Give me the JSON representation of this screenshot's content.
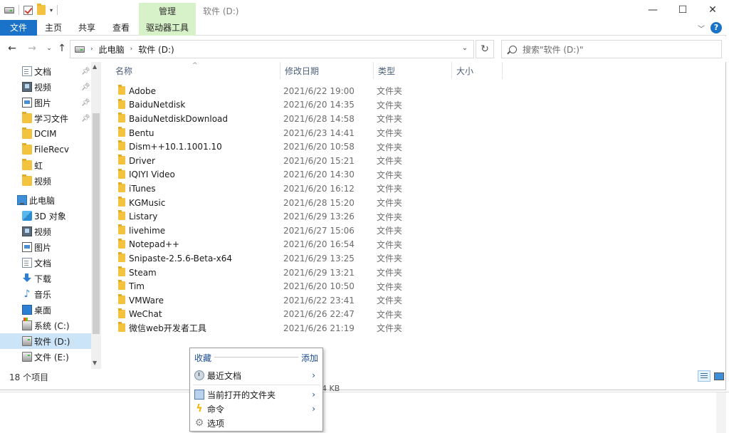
{
  "title_bar": {
    "title": "软件 (D:)",
    "context_tab_group": "管理",
    "minimize_icon": "minimize-icon",
    "maximize_icon": "maximize-icon",
    "close_icon": "close-icon"
  },
  "ribbon": {
    "tabs": [
      "文件",
      "主页",
      "共享",
      "查看",
      "驱动器工具"
    ],
    "help": "?"
  },
  "address": {
    "crumbs": [
      "此电脑",
      "软件 (D:)"
    ],
    "search_placeholder": "搜索\"软件 (D:)\""
  },
  "navpane": {
    "quick_access": [
      {
        "label": "文档",
        "icon": "document-icon",
        "pinned": true
      },
      {
        "label": "视频",
        "icon": "video-icon",
        "pinned": true
      },
      {
        "label": "图片",
        "icon": "picture-icon",
        "pinned": true
      },
      {
        "label": "学习文件",
        "icon": "folder-icon",
        "pinned": true
      },
      {
        "label": "DCIM",
        "icon": "folder-icon",
        "pinned": false
      },
      {
        "label": "FileRecv",
        "icon": "folder-icon",
        "pinned": false
      },
      {
        "label": "虹",
        "icon": "folder-icon",
        "pinned": false
      },
      {
        "label": "视频",
        "icon": "folder-icon",
        "pinned": false
      }
    ],
    "this_pc": "此电脑",
    "pc_items": [
      {
        "label": "3D 对象",
        "icon": "3d-objects-icon"
      },
      {
        "label": "视频",
        "icon": "video-icon"
      },
      {
        "label": "图片",
        "icon": "picture-icon"
      },
      {
        "label": "文档",
        "icon": "document-icon"
      },
      {
        "label": "下载",
        "icon": "download-icon"
      },
      {
        "label": "音乐",
        "icon": "music-icon"
      },
      {
        "label": "桌面",
        "icon": "desktop-icon"
      },
      {
        "label": "系统 (C:)",
        "icon": "system-drive-icon"
      },
      {
        "label": "软件 (D:)",
        "icon": "drive-icon",
        "selected": true
      },
      {
        "label": "文件 (E:)",
        "icon": "drive-icon"
      }
    ]
  },
  "columns": {
    "name": "名称",
    "date": "修改日期",
    "type": "类型",
    "size": "大小"
  },
  "files": [
    {
      "name": "Adobe",
      "date": "2021/6/22 19:00",
      "type": "文件夹"
    },
    {
      "name": "BaiduNetdisk",
      "date": "2021/6/20 14:35",
      "type": "文件夹"
    },
    {
      "name": "BaiduNetdiskDownload",
      "date": "2021/6/28 14:58",
      "type": "文件夹"
    },
    {
      "name": "Bentu",
      "date": "2021/6/23 14:41",
      "type": "文件夹"
    },
    {
      "name": "Dism++10.1.1001.10",
      "date": "2021/6/20 10:58",
      "type": "文件夹"
    },
    {
      "name": "Driver",
      "date": "2021/6/20 15:21",
      "type": "文件夹"
    },
    {
      "name": "IQIYI Video",
      "date": "2021/6/20 14:30",
      "type": "文件夹"
    },
    {
      "name": "iTunes",
      "date": "2021/6/20 16:12",
      "type": "文件夹"
    },
    {
      "name": "KGMusic",
      "date": "2021/6/28 15:20",
      "type": "文件夹"
    },
    {
      "name": "Listary",
      "date": "2021/6/29 13:26",
      "type": "文件夹"
    },
    {
      "name": "livehime",
      "date": "2021/6/27 15:06",
      "type": "文件夹"
    },
    {
      "name": "Notepad++",
      "date": "2021/6/20 16:54",
      "type": "文件夹"
    },
    {
      "name": "Snipaste-2.5.6-Beta-x64",
      "date": "2021/6/29 13:25",
      "type": "文件夹"
    },
    {
      "name": "Steam",
      "date": "2021/6/29 13:21",
      "type": "文件夹"
    },
    {
      "name": "Tim",
      "date": "2021/6/20 10:50",
      "type": "文件夹"
    },
    {
      "name": "VMWare",
      "date": "2021/6/22 23:41",
      "type": "文件夹"
    },
    {
      "name": "WeChat",
      "date": "2021/6/26 22:47",
      "type": "文件夹"
    },
    {
      "name": "微信web开发者工具",
      "date": "2021/6/26 21:19",
      "type": "文件夹"
    }
  ],
  "status": {
    "count": "18 个项目",
    "behind_size": "4 KB"
  },
  "popup": {
    "title": "收藏",
    "add": "添加",
    "items": [
      {
        "label": "最近文档",
        "icon": "recent-docs-icon",
        "submenu": true
      },
      {
        "label": "当前打开的文件夹",
        "icon": "open-folders-icon",
        "submenu": true
      },
      {
        "label": "命令",
        "icon": "lightning-icon",
        "submenu": true
      },
      {
        "label": "选项",
        "icon": "gear-icon",
        "submenu": false
      }
    ]
  },
  "colors": {
    "accent": "#1a73c9",
    "manage_tab": "#d7f1c9",
    "selected": "#cce4f7",
    "folder": "#f3c340",
    "menu_link": "#1b4b91"
  }
}
